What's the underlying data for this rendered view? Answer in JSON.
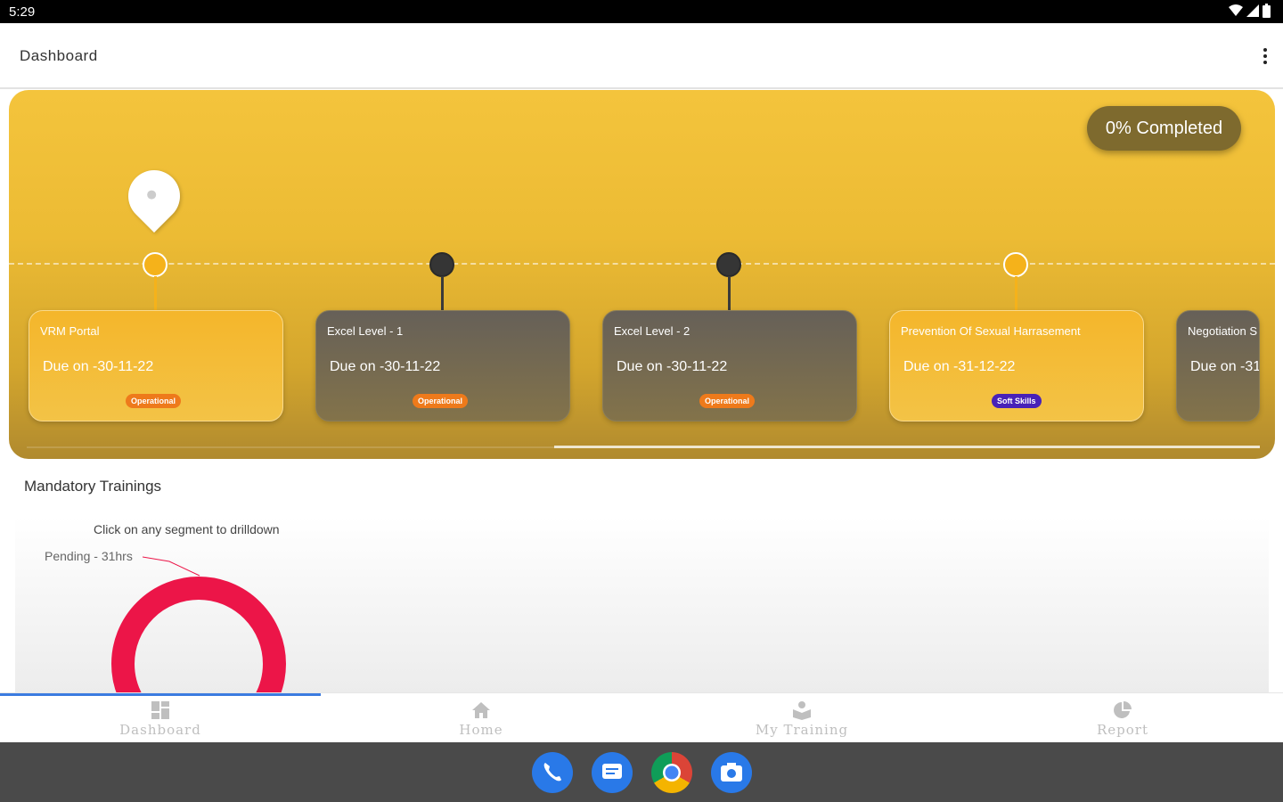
{
  "status": {
    "time": "5:29"
  },
  "appbar": {
    "title": "Dashboard"
  },
  "banner": {
    "completed_label": "0% Completed",
    "cards": [
      {
        "title": "VRM Portal",
        "due": "Due on -30-11-22",
        "tag": "Operational"
      },
      {
        "title": "Excel Level - 1",
        "due": "Due on -30-11-22",
        "tag": "Operational"
      },
      {
        "title": "Excel Level - 2",
        "due": "Due on -30-11-22",
        "tag": "Operational"
      },
      {
        "title": "Prevention Of Sexual Harrasement",
        "due": "Due on -31-12-22",
        "tag": "Soft Skills"
      },
      {
        "title": "Negotiation S",
        "due": "Due on -31-",
        "tag": ""
      }
    ]
  },
  "mandatory": {
    "title": "Mandatory Trainings",
    "hint": "Click on any segment to drilldown",
    "pending_label": "Pending - 31hrs"
  },
  "chart_data": {
    "type": "pie",
    "categories": [
      "Pending"
    ],
    "values": [
      31
    ],
    "colors": [
      "#ec1548"
    ]
  },
  "nav": {
    "items": [
      {
        "label": "Dashboard",
        "icon": "dashboard-icon"
      },
      {
        "label": "Home",
        "icon": "home-icon"
      },
      {
        "label": "My Training",
        "icon": "training-icon"
      },
      {
        "label": "Report",
        "icon": "report-icon"
      }
    ]
  },
  "dock": {
    "apps": [
      "phone-icon",
      "messages-icon",
      "chrome-icon",
      "camera-icon"
    ]
  }
}
